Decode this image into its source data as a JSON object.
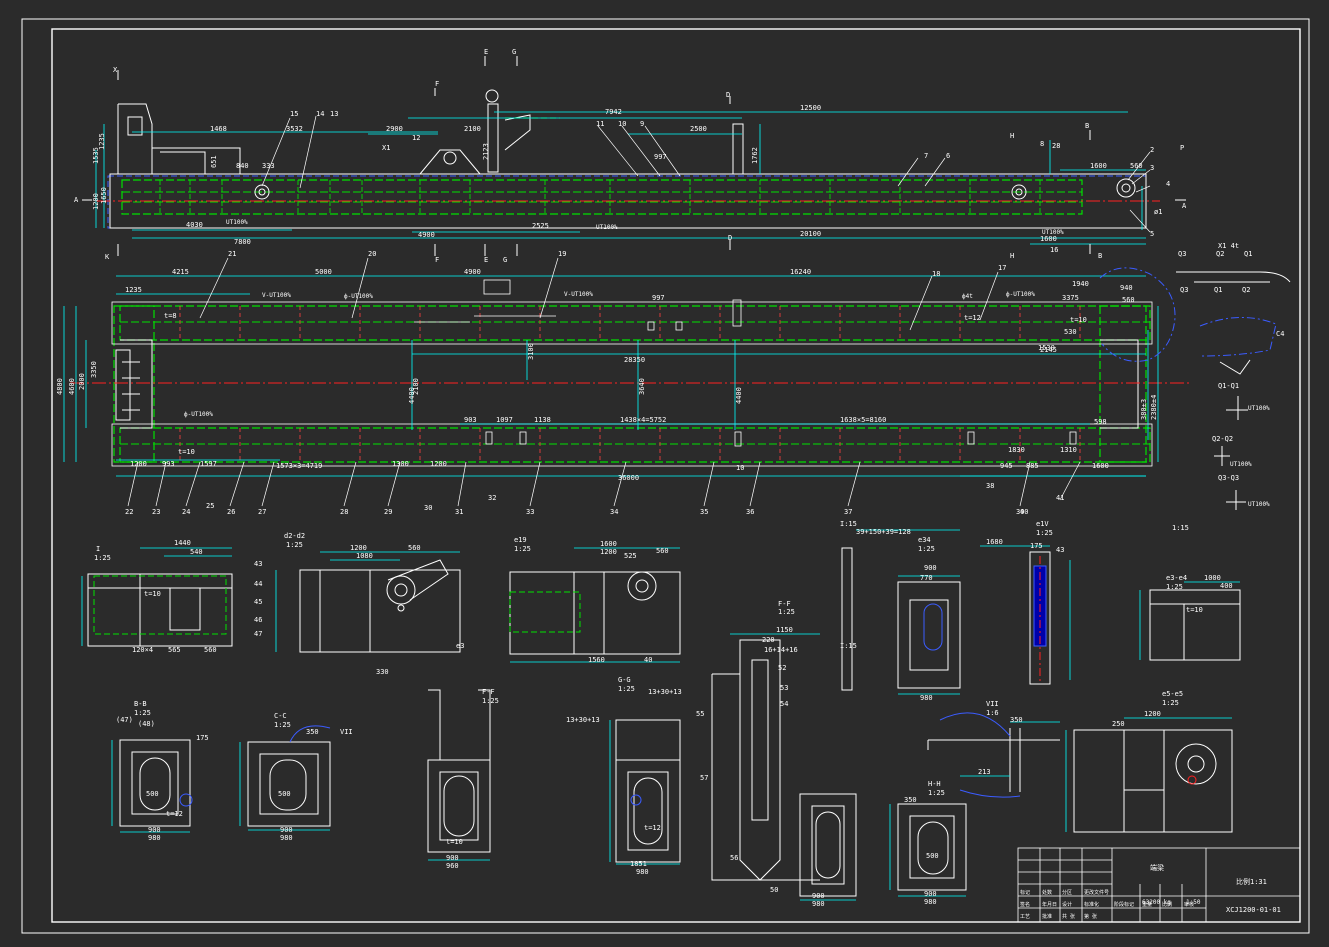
{
  "colors": {
    "background": "#2b2b2b",
    "border": "#ffffff",
    "outline": "#ffffff",
    "dimension": "#00ffff",
    "weld": "#00ff00",
    "centerline": "#ff0000",
    "hidden": "#0000ff",
    "leader": "#ffff00",
    "section": "#ff00ff"
  },
  "top_view": {
    "dims": [
      "12500",
      "7942",
      "3532",
      "1468",
      "2900",
      "2100",
      "2500",
      "997",
      "1762",
      "2123",
      "2525",
      "4900",
      "7800",
      "4030",
      "20100",
      "1600",
      "1200",
      "1650",
      "1600",
      "1535",
      "1235",
      "125",
      "5",
      "0",
      "560",
      "5",
      "28",
      "26",
      "33",
      "ø1",
      "8",
      "20"
    ],
    "labels": [
      "A",
      "A",
      "B",
      "B",
      "H",
      "H",
      "D",
      "D",
      "E",
      "E",
      "F",
      "F",
      "G",
      "G",
      "K",
      "K",
      "X1",
      "X1",
      "14",
      "13",
      "11",
      "10",
      "9",
      "12",
      "15",
      "16",
      "7",
      "6",
      "3",
      "2",
      "1",
      "4",
      "5",
      "P",
      "8"
    ],
    "ut_notes": [
      "UT100%",
      "UT100%",
      "UT100%"
    ]
  },
  "plan_view": {
    "dims": [
      "4215",
      "5000",
      "4900",
      "16240",
      "1940",
      "1235",
      "3375",
      "940",
      "560",
      "28350",
      "36000",
      "997",
      "3100",
      "3640",
      "4400",
      "4400",
      "4800",
      "4600",
      "2000",
      "3350",
      "3400",
      "380±3",
      "2380±4",
      "1573×3=4719",
      "1438×4=5752",
      "1638×5=8160",
      "903",
      "1097",
      "1138",
      "1830",
      "1310",
      "1600",
      "945",
      "885",
      "1200",
      "1300",
      "993",
      "1597",
      "580",
      "10",
      "10",
      "12",
      "12",
      "598",
      "1530",
      "2145"
    ],
    "labels": [
      "21",
      "20",
      "19",
      "18",
      "17",
      "22",
      "23",
      "24",
      "25",
      "26",
      "27",
      "28",
      "29",
      "30",
      "31",
      "32",
      "33",
      "34",
      "35",
      "36",
      "37",
      "38",
      "39",
      "40",
      "41",
      "t=8",
      "t=10",
      "t=12",
      "t=12",
      "t=10"
    ],
    "ut_notes": [
      "V-UT100%",
      "V-UT100%",
      "V-UT100%",
      "UT100%",
      "UT100%",
      "UT100%"
    ]
  },
  "side_details": {
    "titles": [
      "X1 4t",
      "C4",
      "Q1-Q1",
      "Q2-Q2",
      "Q3-Q3"
    ],
    "labels": [
      "Q2",
      "Q1",
      "Q3",
      "Q1",
      "Q2",
      "Q3",
      "P"
    ],
    "notes": [
      "UT100%",
      "UT100%",
      "UT100%"
    ]
  },
  "sections": [
    {
      "title": "I",
      "scale": "1:25",
      "dims": [
        "1440",
        "540",
        "625",
        "900",
        "120×4",
        "565",
        "560",
        "150",
        "175",
        "1250",
        "1000",
        "1150",
        "1350",
        "1250",
        "125",
        "40",
        "70",
        "10",
        "12",
        "t=10",
        "43"
      ]
    },
    {
      "title": "d2-d2",
      "scale": "1:25",
      "dims": [
        "1200",
        "1080",
        "560",
        "330",
        "ø150",
        "R25",
        "1080",
        "130",
        "5",
        "450",
        "16",
        "30",
        "t=12",
        "40"
      ],
      "labels": [
        "43",
        "44",
        "45",
        "46",
        "47",
        "49",
        "UT100%",
        "CTYP",
        "e3"
      ]
    },
    {
      "title": "e19",
      "scale": "1:25",
      "dims": [
        "1600",
        "1200",
        "525",
        "560",
        "1000",
        "1560",
        "230",
        "1200",
        "1300",
        "1300",
        "35",
        "40"
      ],
      "labels": [
        "10",
        "UT100%",
        "CTYP",
        "t=12"
      ]
    },
    {
      "title": "I-I",
      "scale": "1:25",
      "dims": [
        "220",
        "1150",
        "16+14+16",
        "150",
        "250",
        "208",
        "1200",
        "1000",
        "500",
        "1300",
        "1300",
        "900",
        "980",
        "P123"
      ],
      "labels": [
        "e1",
        "F-F",
        "52",
        "53",
        "54",
        "55",
        "56",
        "57",
        "58",
        "50",
        "1:25",
        "UT100%"
      ]
    },
    {
      "title": "e34",
      "scale": "1:25",
      "dims": [
        "39+150+39=128",
        "900",
        "770",
        "160",
        "175",
        "128",
        "48",
        "80",
        "729",
        "980",
        "520",
        "1300",
        "150",
        "42",
        "43",
        "12",
        "50",
        "60"
      ],
      "labels": [
        "I:15",
        "I:15",
        "UT100%",
        "UT100%"
      ]
    },
    {
      "title": "e1V",
      "scale": "1:25",
      "dims": [
        "175",
        "43",
        "1680",
        "148",
        "150",
        "1440",
        "380",
        "300",
        "720",
        "7150",
        "60"
      ],
      "labels": [
        "UT100%",
        "TYP",
        "UT100%",
        "TYP"
      ]
    },
    {
      "title": "e3-e4",
      "scale": "1:25",
      "dims": [
        "1000",
        "400",
        "900",
        "1300",
        "t=10",
        "128",
        "150",
        "12",
        "12"
      ],
      "labels": [
        "1:15",
        "UT100%",
        "UT100%"
      ]
    },
    {
      "title": "B-B",
      "scale": "1:25",
      "dims": [
        "(47)",
        "(48)",
        "150",
        "175",
        "1300",
        "500",
        "900",
        "980",
        "t=12",
        "R150",
        "20",
        "15",
        "40",
        "75",
        "25",
        "10",
        "10"
      ],
      "labels": [
        "ф400(300)±3"
      ]
    },
    {
      "title": "C-C",
      "scale": "1:25",
      "dims": [
        "350",
        "500",
        "600",
        "1300",
        "900",
        "980",
        "30",
        "R150",
        "30",
        "12",
        "10"
      ],
      "labels": [
        "ф400(300)±3",
        "UT100%",
        "VII"
      ]
    },
    {
      "title": "F-F",
      "scale": "1:25",
      "dims": [
        "130",
        "580",
        "1300",
        "300",
        "t=10",
        "900",
        "900",
        "960",
        "180",
        "45",
        "40",
        "25",
        "12",
        "30",
        "12"
      ],
      "labels": [
        "UT100%",
        "C"
      ]
    },
    {
      "title": "G-G",
      "scale": "1:25",
      "dims": [
        "13+30+13",
        "13+30+13",
        "250",
        "250",
        "345",
        "1600",
        "1200",
        "900",
        "185",
        "180",
        "30",
        "t=12",
        "R20",
        "40",
        "45"
      ],
      "labels": [
        "ф330±2",
        "ф330±2",
        "UT100%",
        "UT100%"
      ]
    },
    {
      "title": "VII",
      "scale": "1:6",
      "dims": [
        "350",
        "13",
        "213",
        "147",
        "45",
        "55",
        "35",
        "50",
        "70"
      ],
      "labels": [
        "ф440(300)±3"
      ]
    },
    {
      "title": "H-H",
      "scale": "1:25",
      "dims": [
        "350",
        "R150",
        "500",
        "600",
        "1300",
        "900",
        "980",
        "t=12",
        "12",
        "55",
        "30"
      ],
      "labels": [
        "UT100%"
      ]
    },
    {
      "title": "e5-e5",
      "scale": "1:25",
      "dims": [
        "1200",
        "250",
        "1300",
        "R400",
        "R275",
        "R300",
        "R500",
        "10",
        "15",
        "50"
      ],
      "labels": [
        "CTYP"
      ]
    }
  ],
  "title_block": {
    "drawing_name": "端梁",
    "scale_text": "比例1:31",
    "drawing_no": "XCJ1200-01-01",
    "scale_small": "1:50",
    "weight": "63200 kg",
    "cells": [
      "标记",
      "处数",
      "分区",
      "更改文件号",
      "签名",
      "年月日",
      "设计",
      "标准化",
      "阶段标记",
      "重量",
      "比例",
      "审核",
      "工艺",
      "批准",
      "共 张",
      "第 张"
    ]
  }
}
